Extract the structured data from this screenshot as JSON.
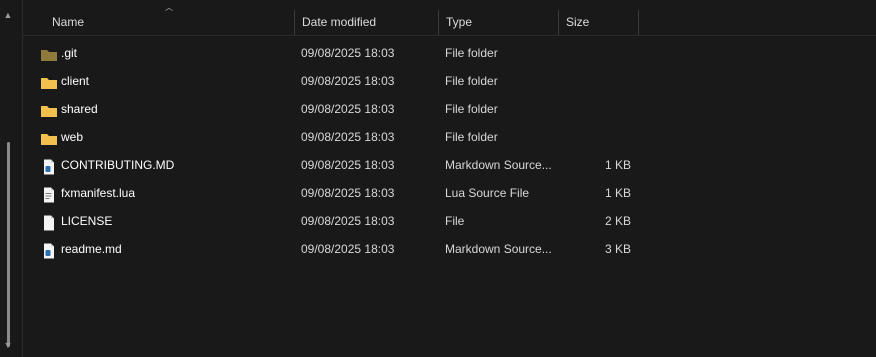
{
  "header": {
    "name_label": "Name",
    "date_label": "Date modified",
    "type_label": "Type",
    "size_label": "Size"
  },
  "rows": [
    {
      "name": ".git",
      "date": "09/08/2025 18:03",
      "type": "File folder",
      "size": "",
      "icon": "folder-dim-icon"
    },
    {
      "name": "client",
      "date": "09/08/2025 18:03",
      "type": "File folder",
      "size": "",
      "icon": "folder-icon"
    },
    {
      "name": "shared",
      "date": "09/08/2025 18:03",
      "type": "File folder",
      "size": "",
      "icon": "folder-icon"
    },
    {
      "name": "web",
      "date": "09/08/2025 18:03",
      "type": "File folder",
      "size": "",
      "icon": "folder-icon"
    },
    {
      "name": "CONTRIBUTING.MD",
      "date": "09/08/2025 18:03",
      "type": "Markdown Source...",
      "size": "1 KB",
      "icon": "markdown-file-icon"
    },
    {
      "name": "fxmanifest.lua",
      "date": "09/08/2025 18:03",
      "type": "Lua Source File",
      "size": "1 KB",
      "icon": "lua-file-icon"
    },
    {
      "name": "LICENSE",
      "date": "09/08/2025 18:03",
      "type": "File",
      "size": "2 KB",
      "icon": "blank-file-icon"
    },
    {
      "name": "readme.md",
      "date": "09/08/2025 18:03",
      "type": "Markdown Source...",
      "size": "3 KB",
      "icon": "markdown-file-icon"
    }
  ],
  "colors": {
    "background": "#191919",
    "folder": "#f2c14e",
    "folder_dim": "#8f7a3e"
  }
}
